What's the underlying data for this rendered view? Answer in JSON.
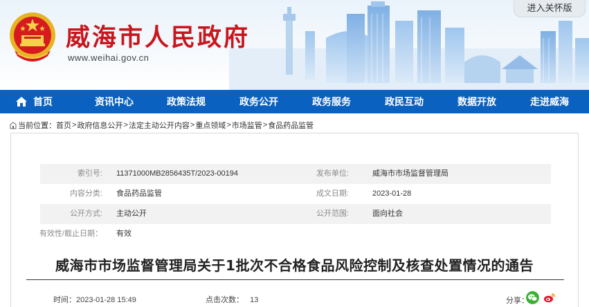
{
  "header": {
    "site_title": "威海市人民政府",
    "site_url": "www.weihai.gov.cn",
    "care_version_button": "进入关怀版"
  },
  "nav": {
    "items": [
      {
        "label": "首页",
        "icon": "home-icon"
      },
      {
        "label": "资讯中心"
      },
      {
        "label": "政策法规"
      },
      {
        "label": "政务公开"
      },
      {
        "label": "政务服务"
      },
      {
        "label": "政民互动"
      },
      {
        "label": "数据开放"
      },
      {
        "label": "走进威海"
      }
    ]
  },
  "breadcrumb": {
    "prefix": "当前位置：",
    "items": [
      "首页",
      "政府信息公开",
      "法定主动公开内容",
      "重点领域",
      "市场监管",
      "食品药品监管"
    ],
    "separator": ">"
  },
  "meta": {
    "rows": [
      {
        "label1": "索引号:",
        "value1": "11371000MB2856435T/2023-00194",
        "label2": "发布单位:",
        "value2": "威海市市场监督管理局"
      },
      {
        "label1": "内容分类:",
        "value1": "食品药品监管",
        "label2": "成文日期:",
        "value2": "2023-01-28"
      },
      {
        "label1": "公开方式:",
        "value1": "主动公开",
        "label2": "公开范围:",
        "value2": "面向社会"
      },
      {
        "label1": "有效性/截止日期：",
        "value1": "有效",
        "label2": "",
        "value2": ""
      }
    ]
  },
  "article": {
    "title": "威海市市场监督管理局关于1批次不合格食品风险控制及核查处置情况的通告",
    "time_label": "时间：",
    "time_value": "2023-01-28 15:49",
    "views_label": "点击次数：",
    "views_value": "13",
    "share_label": "分享：",
    "share_icons": [
      "wechat-icon",
      "weibo-icon"
    ]
  },
  "colors": {
    "nav_bg": "#0b61bf",
    "title_red": "#c8161d",
    "meta_shade": "#f2f2f2",
    "wechat": "#3cb034",
    "weibo": "#e6162d"
  }
}
